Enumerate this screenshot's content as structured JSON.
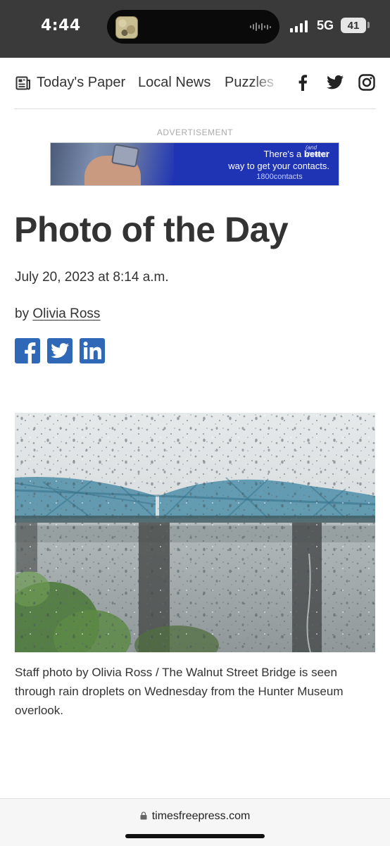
{
  "status_bar": {
    "time": "4:44",
    "network": "5G",
    "battery": "41"
  },
  "nav": {
    "items": [
      {
        "label": "Today's Paper",
        "icon": "newspaper-icon"
      },
      {
        "label": "Local News"
      },
      {
        "label": "Puzzles"
      }
    ],
    "social": [
      "facebook-icon",
      "twitter-icon",
      "instagram-icon"
    ]
  },
  "ad": {
    "label": "ADVERTISEMENT",
    "line1_pre": "There's a ",
    "line1_bold": "better",
    "line2": "way to get your contacts.",
    "brand": "1800contacts",
    "scribble": "(and cheaper)"
  },
  "article": {
    "title": "Photo of the Day",
    "date": "July 20, 2023 at 8:14 a.m.",
    "by_prefix": "by",
    "author": "Olivia Ross",
    "share": [
      "facebook-icon",
      "twitter-icon",
      "linkedin-icon"
    ],
    "caption": "Staff photo by Olivia Ross / The Walnut Street Bridge is seen through rain droplets on Wednesday from the Hunter Museum overlook."
  },
  "browser": {
    "url": "timesfreepress.com"
  },
  "colors": {
    "status_bar_bg": "#3a3a3a",
    "share_blue": "#2f68b6",
    "ad_blue": "#1f33b5",
    "text": "#333333"
  }
}
